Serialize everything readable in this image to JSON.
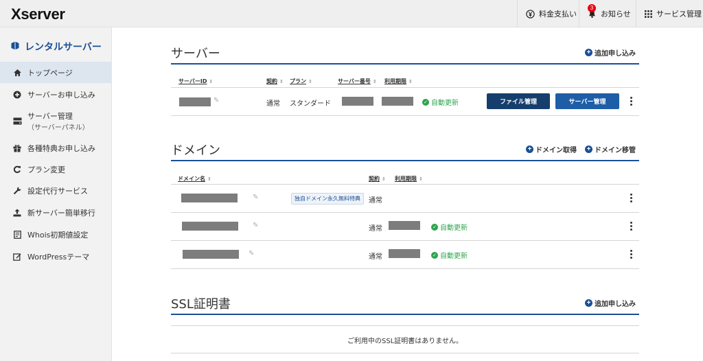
{
  "header": {
    "logo": "Xserver",
    "payment": "料金支払い",
    "notice": "お知らせ",
    "notice_count": "3",
    "service": "サービス管理"
  },
  "sidebar": {
    "title": "レンタルサーバー",
    "items": [
      {
        "label": "トップページ",
        "icon": "home-icon"
      },
      {
        "label": "サーバーお申し込み",
        "icon": "plus-circle-icon"
      },
      {
        "label": "サーバー管理",
        "sub": "（サーバーパネル）",
        "icon": "server-icon"
      },
      {
        "label": "各種特典お申し込み",
        "icon": "gift-icon"
      },
      {
        "label": "プラン変更",
        "icon": "refresh-icon"
      },
      {
        "label": "設定代行サービス",
        "icon": "wrench-icon"
      },
      {
        "label": "新サーバー簡単移行",
        "icon": "upload-icon"
      },
      {
        "label": "Whois初期値設定",
        "icon": "document-icon"
      },
      {
        "label": "WordPressテーマ",
        "icon": "edit-icon"
      }
    ]
  },
  "server": {
    "title": "サーバー",
    "add": "追加申し込み",
    "columns": {
      "id": "サーバーID",
      "contract": "契約",
      "plan": "プラン",
      "number": "サーバー番号",
      "expiry": "利用期限"
    },
    "row": {
      "contract": "通常",
      "plan": "スタンダード",
      "auto": "自動更新",
      "file_btn": "ファイル管理",
      "panel_btn": "サーバー管理"
    }
  },
  "domain": {
    "title": "ドメイン",
    "acquire": "ドメイン取得",
    "transfer": "ドメイン移管",
    "columns": {
      "name": "ドメイン名",
      "contract": "契約",
      "expiry": "利用期限"
    },
    "rows": [
      {
        "tag": "独自ドメイン永久無料特典",
        "contract": "通常",
        "auto": ""
      },
      {
        "tag": "",
        "contract": "通常",
        "auto": "自動更新"
      },
      {
        "tag": "",
        "contract": "通常",
        "auto": "自動更新"
      }
    ]
  },
  "ssl": {
    "title": "SSL証明書",
    "add": "追加申し込み",
    "empty": "ご利用中のSSL証明書はありません。"
  },
  "colors": {
    "brand": "#1a4f96",
    "auto": "#2ea44f",
    "dark_button": "#163e6d"
  }
}
